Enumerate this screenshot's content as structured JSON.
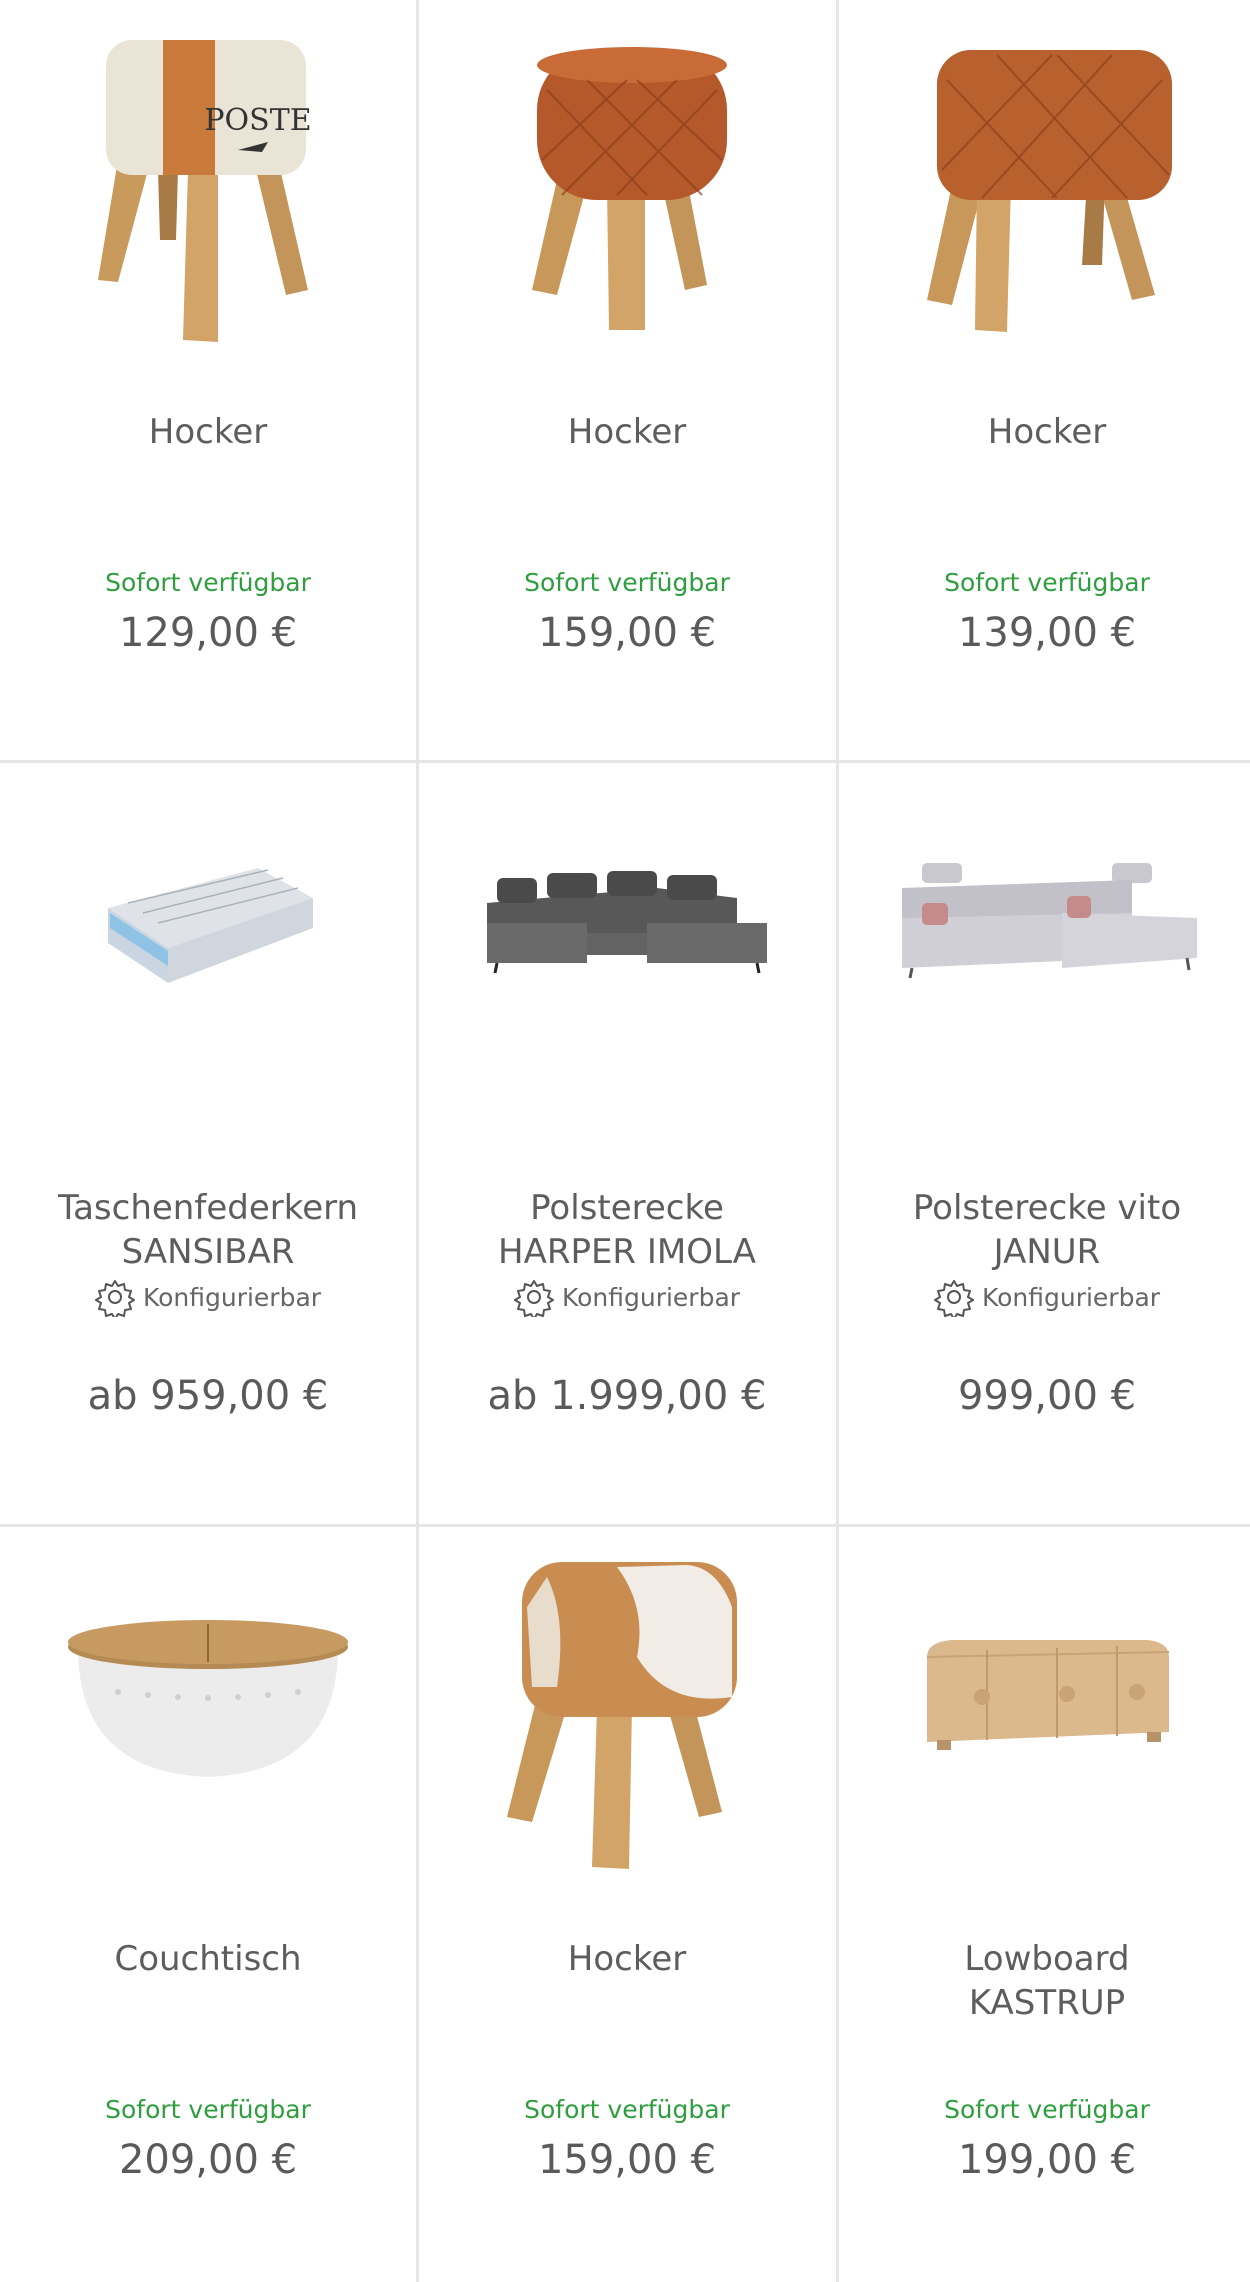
{
  "products": [
    {
      "name": "Hocker",
      "availability": "Sofort verfügbar",
      "price": "129,00 €",
      "image_icon": "leather-stool-poste-icon"
    },
    {
      "name": "Hocker",
      "availability": "Sofort verfügbar",
      "price": "159,00 €",
      "image_icon": "round-quilted-stool-icon"
    },
    {
      "name": "Hocker",
      "availability": "Sofort verfügbar",
      "price": "139,00 €",
      "image_icon": "quilted-bench-stool-icon"
    },
    {
      "name_line1": "Taschenfederkern",
      "name_line2": "SANSIBAR",
      "config_label": "Konfigurierbar",
      "price": "ab 959,00 €",
      "image_icon": "mattress-icon"
    },
    {
      "name_line1": "Polsterecke",
      "name_line2": "HARPER IMOLA",
      "config_label": "Konfigurierbar",
      "price": "ab 1.999,00 €",
      "image_icon": "corner-sofa-dark-icon"
    },
    {
      "name_line1": "Polsterecke vito",
      "name_line2": "JANUR",
      "config_label": "Konfigurierbar",
      "price": "999,00 €",
      "image_icon": "corner-sofa-light-icon"
    },
    {
      "name": "Couchtisch",
      "availability": "Sofort verfügbar",
      "price": "209,00 €",
      "image_icon": "drum-coffee-table-icon"
    },
    {
      "name": "Hocker",
      "availability": "Sofort verfügbar",
      "price": "159,00 €",
      "image_icon": "cowhide-stool-icon"
    },
    {
      "name_line1": "Lowboard",
      "name_line2": "KASTRUP",
      "availability": "Sofort verfügbar",
      "price": "199,00 €",
      "image_icon": "lowboard-icon"
    }
  ],
  "colors": {
    "availability_green": "#2e9e3e",
    "divider": "#e4e6e8",
    "text": "#5a5a5a"
  }
}
